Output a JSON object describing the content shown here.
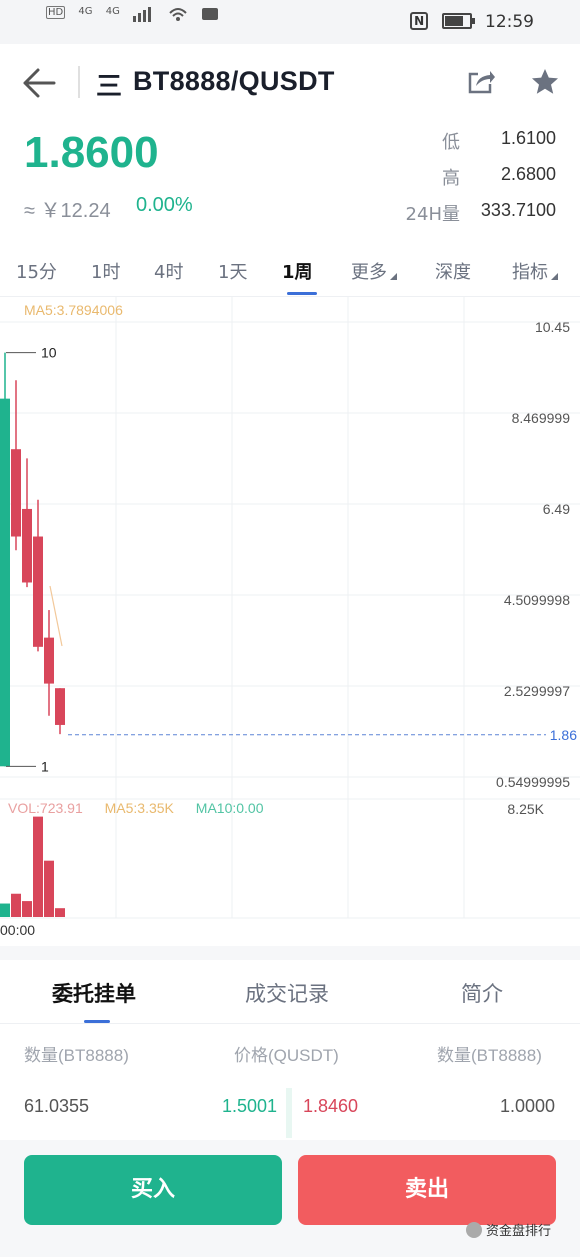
{
  "status_bar": {
    "hd_label": "HD",
    "network_1": "4G",
    "network_2": "4G",
    "nfc": "N",
    "time": "12:59"
  },
  "header": {
    "menu_glyph": "三",
    "pair": "BT8888/QUSDT"
  },
  "ticker": {
    "last_price": "1.8600",
    "approx_value": "≈ ￥12.24",
    "change_pct": "0.00%",
    "low_label": "低",
    "low_value": "1.6100",
    "high_label": "高",
    "high_value": "2.6800",
    "vol_label": "24H量",
    "vol_value": "333.7100"
  },
  "period_tabs": {
    "tab_15m": "15分",
    "tab_1h": "1时",
    "tab_4h": "4时",
    "tab_1d": "1天",
    "tab_1w": "1周",
    "tab_more": "更多",
    "tab_depth": "深度",
    "tab_indicator": "指标"
  },
  "chart_data": {
    "type": "candlestick",
    "ma_label": "MA5:3.7894006",
    "y_ticks": [
      "10.45",
      "8.469999",
      "6.49",
      "4.5099998",
      "2.5299997",
      "0.54999995"
    ],
    "ylim": [
      0.54999995,
      10.45
    ],
    "current_price_line": "1.86",
    "max_marker": "10",
    "min_marker": "1",
    "candles": [
      {
        "open": 1.0,
        "close": 9.0,
        "high": 10.0,
        "low": 1.0,
        "color": "up"
      },
      {
        "open": 7.9,
        "close": 6.0,
        "high": 9.4,
        "low": 5.7,
        "color": "down"
      },
      {
        "open": 6.6,
        "close": 5.0,
        "high": 7.7,
        "low": 4.9,
        "color": "down"
      },
      {
        "open": 6.0,
        "close": 3.6,
        "high": 6.8,
        "low": 3.5,
        "color": "down"
      },
      {
        "open": 3.8,
        "close": 2.8,
        "high": 4.4,
        "low": 2.1,
        "color": "down"
      },
      {
        "open": 2.7,
        "close": 1.9,
        "high": 2.7,
        "low": 1.7,
        "color": "down"
      }
    ],
    "volume": {
      "vol_label": "VOL:723.91",
      "ma5_label": "MA5:3.35K",
      "ma10_label": "MA10:0.00",
      "max_tick": "8.25K",
      "values": [
        1.1,
        1.9,
        1.3,
        8.2,
        4.6,
        0.72
      ]
    },
    "x_labels": [
      "00:00"
    ]
  },
  "bottom_tabs": {
    "orders": "委托挂单",
    "trades": "成交记录",
    "intro": "简介"
  },
  "order_book": {
    "col_amount_left": "数量(BT8888)",
    "col_price": "价格(QUSDT)",
    "col_amount_right": "数量(BT8888)",
    "rows": [
      {
        "bid_amount": "61.0355",
        "bid_price": "1.5001",
        "ask_price": "1.8460",
        "ask_amount": "1.0000"
      }
    ]
  },
  "actions": {
    "buy": "买入",
    "sell": "卖出"
  },
  "watermark": "资金盘排行",
  "colors": {
    "up": "#1fb38e",
    "down": "#d8465a",
    "accent": "#3b6fd8",
    "sell_button": "#f25c5f"
  }
}
